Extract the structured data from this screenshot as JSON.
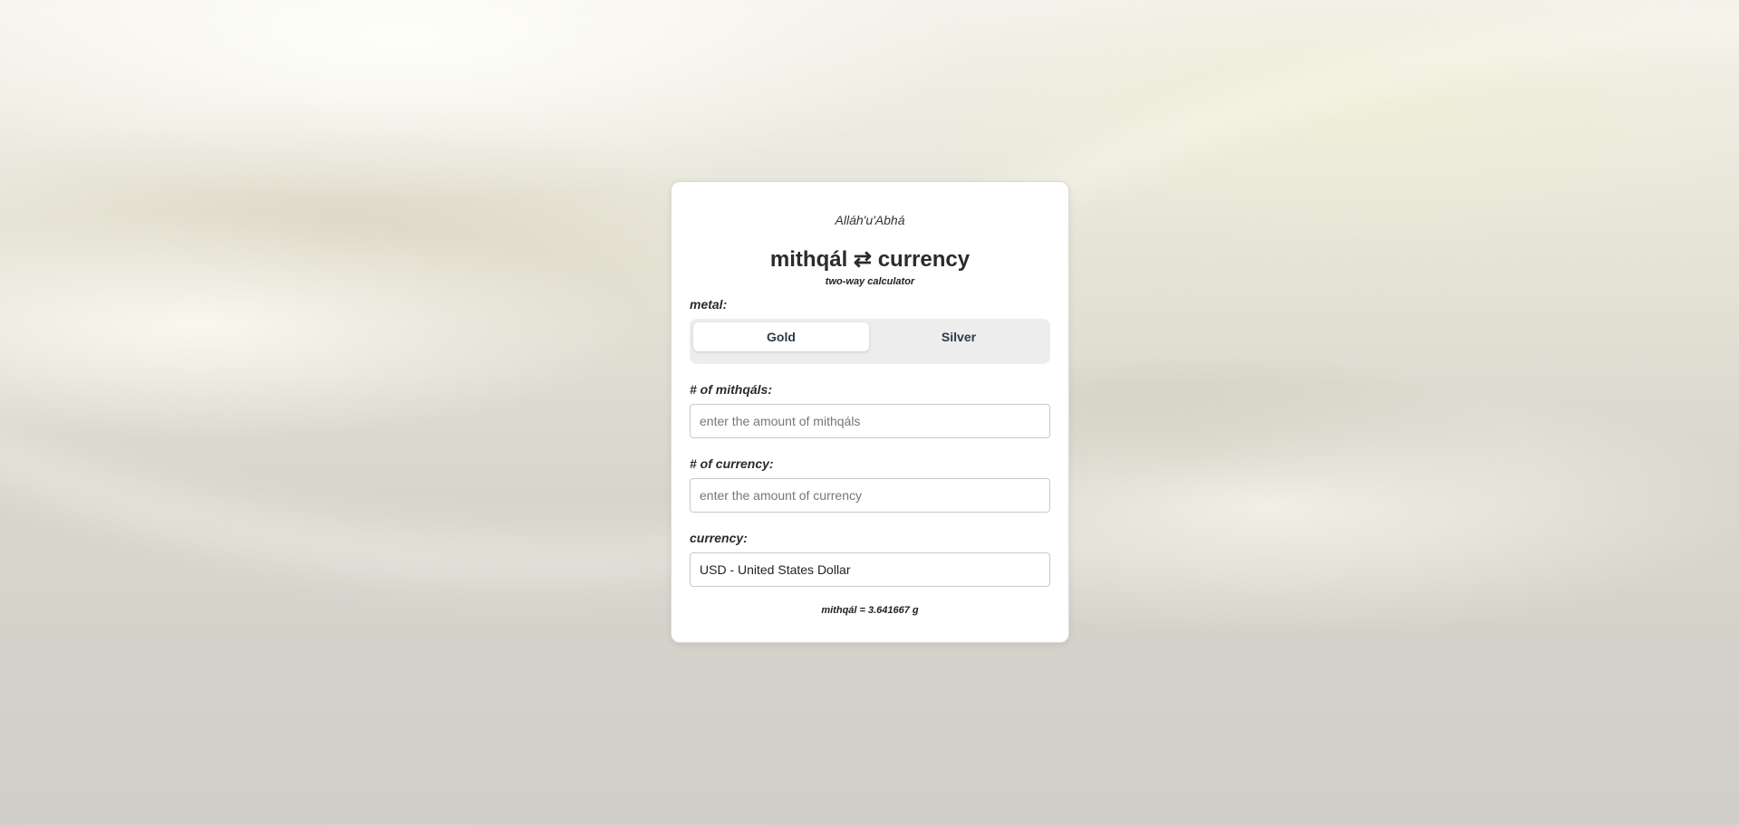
{
  "greeting": "Alláh'u'Abhá",
  "title": "mithqál ⇄ currency",
  "subtitle": "two-way calculator",
  "metal": {
    "label": "metal:",
    "options": [
      "Gold",
      "Silver"
    ],
    "selected": "Gold"
  },
  "mithqals": {
    "label": "# of mithqáls:",
    "placeholder": "enter the amount of mithqáls",
    "value": ""
  },
  "currency_amount": {
    "label": "# of currency:",
    "placeholder": "enter the amount of currency",
    "value": ""
  },
  "currency": {
    "label": "currency:",
    "selected": "USD - United States Dollar"
  },
  "footnote": "mithqál = 3.641667 g",
  "colors": {
    "card_bg": "#ffffff",
    "segmented_bg": "#ededed",
    "segment_text": "#2f3b4a",
    "text": "#2b2b2b"
  }
}
